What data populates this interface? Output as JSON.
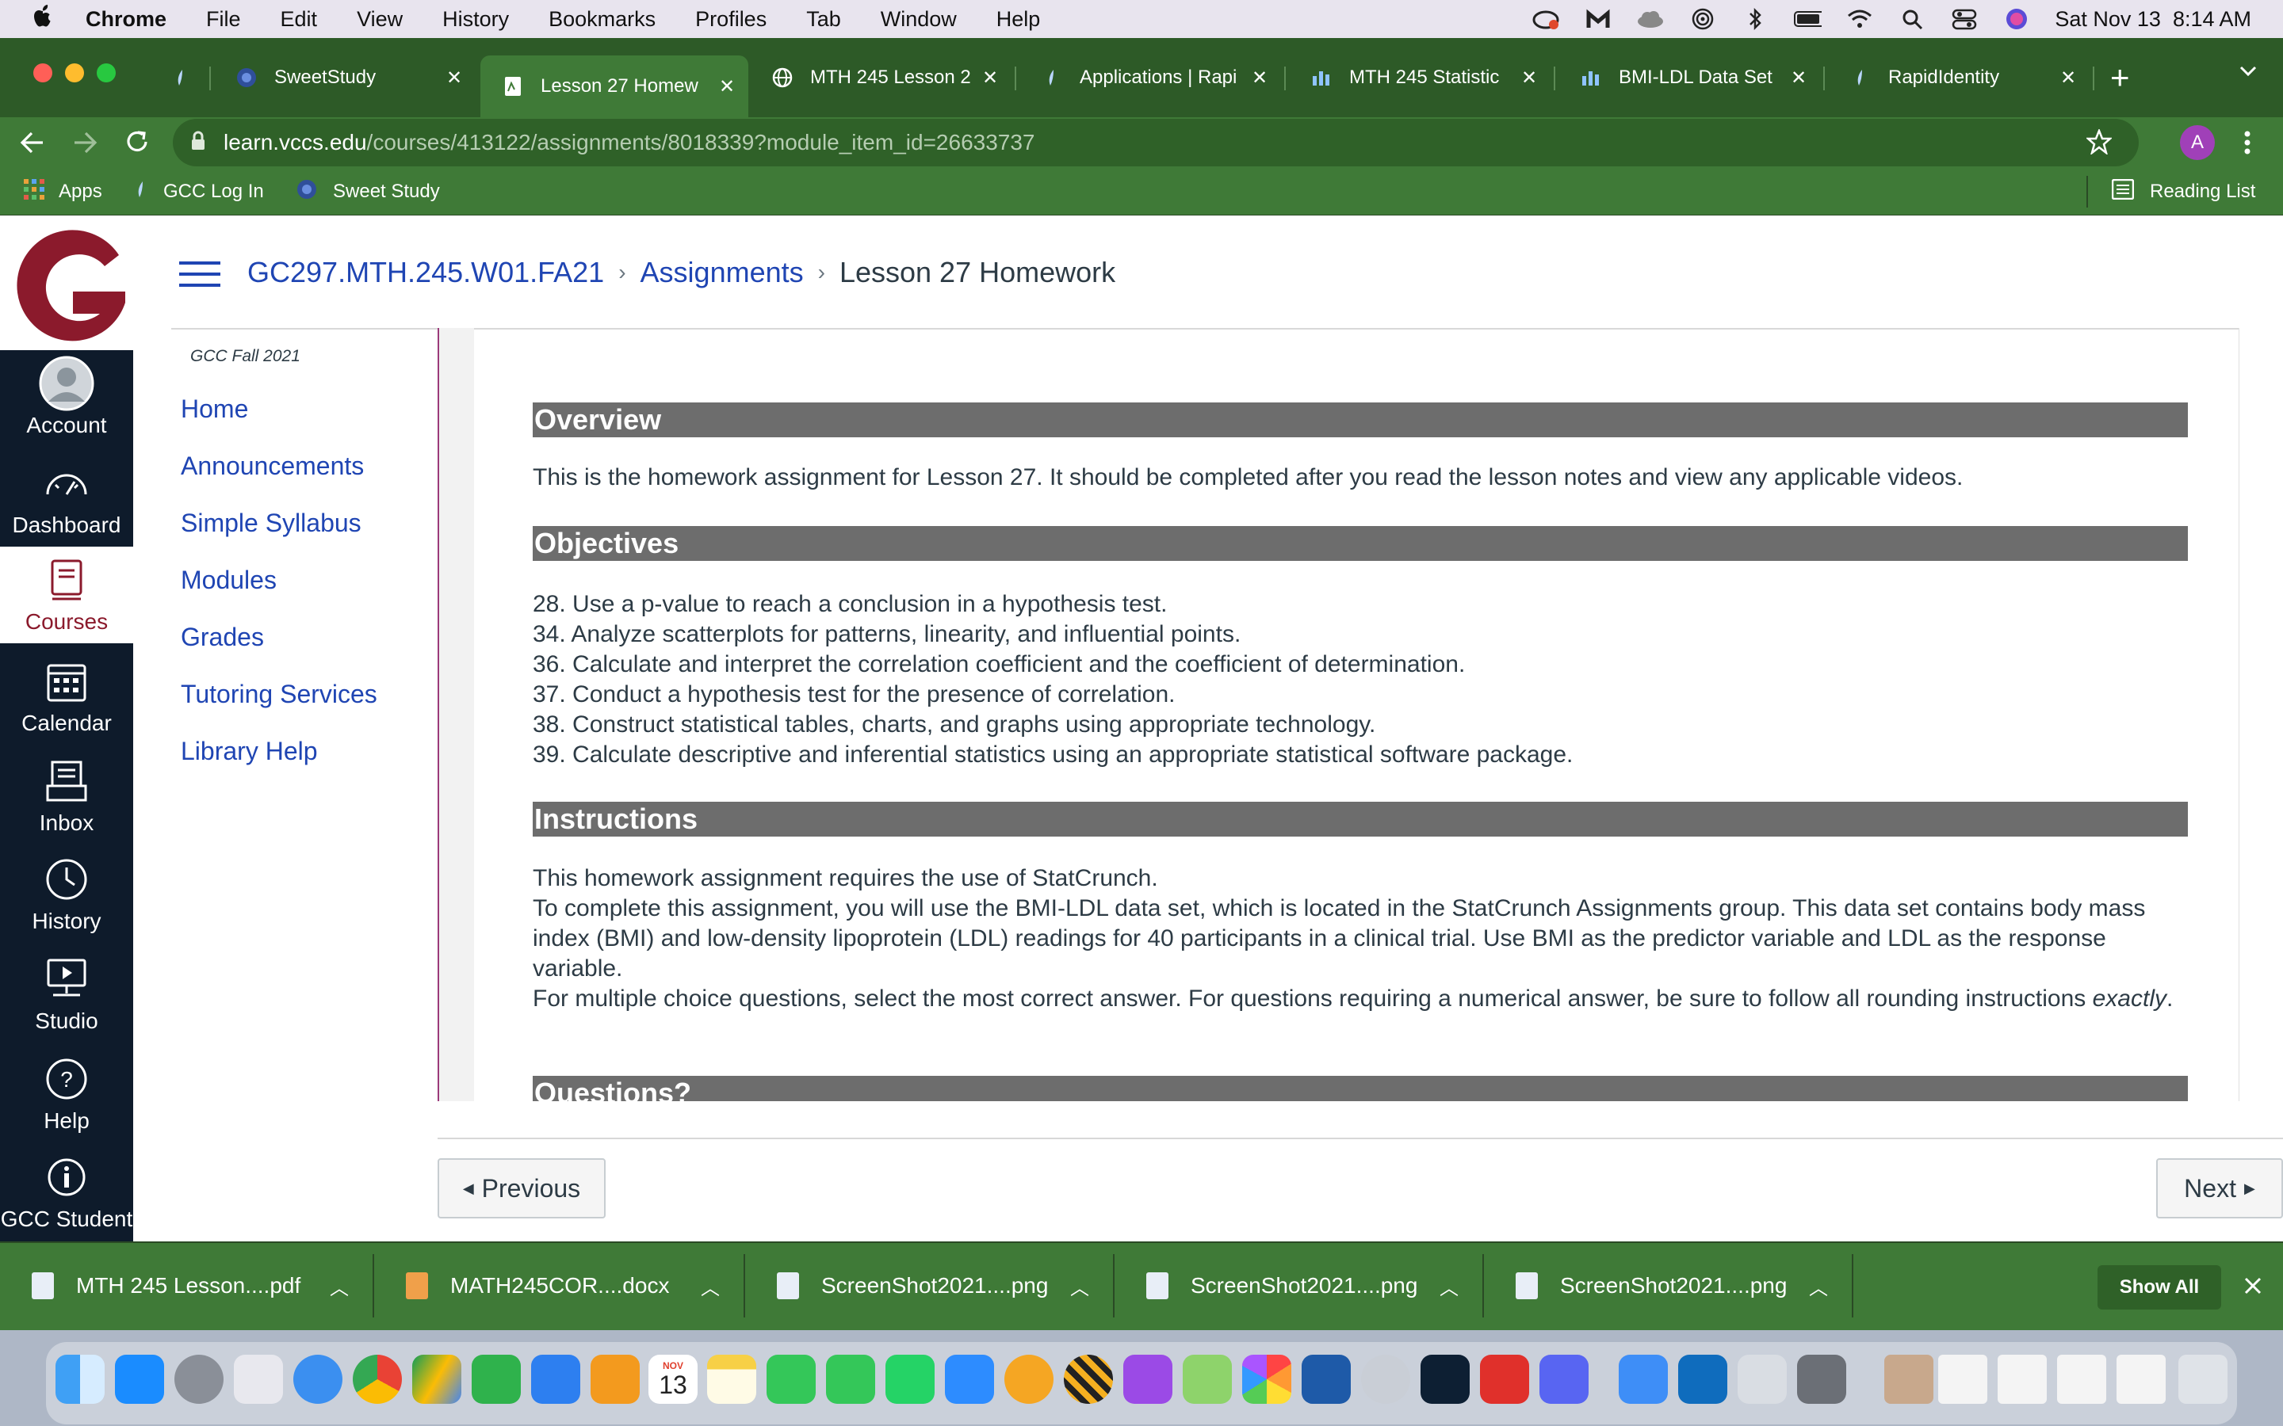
{
  "menubar": {
    "apple": "",
    "app_name": "Chrome",
    "items": [
      "File",
      "Edit",
      "View",
      "History",
      "Bookmarks",
      "Profiles",
      "Tab",
      "Window",
      "Help"
    ],
    "clock": "Sat Nov 13  8:14 AM"
  },
  "tabs": [
    {
      "title": "",
      "icon": "generic-favicon-icon",
      "active": false
    },
    {
      "title": "SweetStudy",
      "icon": "sweetstudy-icon",
      "active": false
    },
    {
      "title": "Lesson 27 Homew",
      "icon": "canvas-doc-icon",
      "active": true
    },
    {
      "title": "MTH 245 Lesson 2",
      "icon": "globe-icon",
      "active": false
    },
    {
      "title": "Applications | Rapi",
      "icon": "rapididentity-icon",
      "active": false
    },
    {
      "title": "MTH 245 Statistic",
      "icon": "statcrunch-icon",
      "active": false
    },
    {
      "title": "BMI-LDL Data Set",
      "icon": "statcrunch-icon",
      "active": false
    },
    {
      "title": "RapidIdentity",
      "icon": "rapididentity-icon",
      "active": false
    }
  ],
  "address": {
    "domain": "learn.vccs.edu",
    "path": "/courses/413122/assignments/8018339?module_item_id=26633737"
  },
  "profile_initial": "A",
  "bookmarks": [
    {
      "label": "Apps",
      "icon": "apps-grid-icon"
    },
    {
      "label": "GCC Log In",
      "icon": "rapididentity-icon"
    },
    {
      "label": "Sweet Study",
      "icon": "sweetstudy-icon"
    }
  ],
  "reading_list": "Reading List",
  "global_nav": [
    {
      "label": "Account",
      "icon": "account-icon"
    },
    {
      "label": "Dashboard",
      "icon": "dashboard-icon"
    },
    {
      "label": "Courses",
      "icon": "courses-icon"
    },
    {
      "label": "Calendar",
      "icon": "calendar-icon"
    },
    {
      "label": "Inbox",
      "icon": "inbox-icon"
    },
    {
      "label": "History",
      "icon": "history-icon"
    },
    {
      "label": "Studio",
      "icon": "studio-icon"
    },
    {
      "label": "Help",
      "icon": "help-icon"
    },
    {
      "label": "GCC Student",
      "icon": "info-icon"
    }
  ],
  "breadcrumb": {
    "course": "GC297.MTH.245.W01.FA21",
    "section": "Assignments",
    "current": "Lesson 27 Homework"
  },
  "course_nav": {
    "term": "GCC Fall 2021",
    "items": [
      "Home",
      "Announcements",
      "Simple Syllabus",
      "Modules",
      "Grades",
      "Tutoring Services",
      "Library Help"
    ]
  },
  "content": {
    "overview_heading": "Overview",
    "overview_text": "This is the homework assignment for Lesson 27. It should be completed after you read the lesson notes and view any applicable videos.",
    "objectives_heading": "Objectives",
    "objectives": [
      "28. Use a p-value to reach a conclusion in a hypothesis test.",
      "34. Analyze scatterplots for patterns, linearity, and influential points.",
      "36. Calculate and interpret the correlation coefficient and the coefficient of determination.",
      "37. Conduct a hypothesis test for the presence of correlation.",
      "38. Construct statistical tables, charts, and graphs using appropriate technology.",
      "39. Calculate descriptive and inferential statistics using an appropriate statistical software package."
    ],
    "instructions_heading": "Instructions",
    "instructions_1": "This homework assignment requires the use of StatCrunch.",
    "instructions_2": "To complete this assignment, you will use the BMI-LDL data set, which is located in the StatCrunch Assignments group. This data set contains body mass index (BMI) and low-density lipoprotein (LDL) readings for 40 participants in a clinical trial. Use BMI as the predictor variable and LDL as the response variable.",
    "instructions_3a": "For multiple choice questions, select the most correct answer. For questions requiring a numerical answer, be sure to follow all rounding instructions ",
    "instructions_3b": "exactly",
    "instructions_3c": ".",
    "questions_heading": "Questions?"
  },
  "pager": {
    "previous": "Previous",
    "next": "Next"
  },
  "downloads": {
    "items": [
      "MTH 245 Lesson....pdf",
      "MATH245COR....docx",
      "ScreenShot2021....png",
      "ScreenShot2021....png",
      "ScreenShot2021....png"
    ],
    "show_all": "Show All"
  },
  "dock": {
    "calendar_month": "NOV",
    "calendar_day": "13"
  },
  "colors": {
    "chrome_green": "#3f7a37",
    "canvas_nav": "#0e1b2b",
    "gcc_maroon": "#8b1a2c",
    "link_blue": "#1f45b3",
    "section_gray": "#6d6d6d"
  }
}
